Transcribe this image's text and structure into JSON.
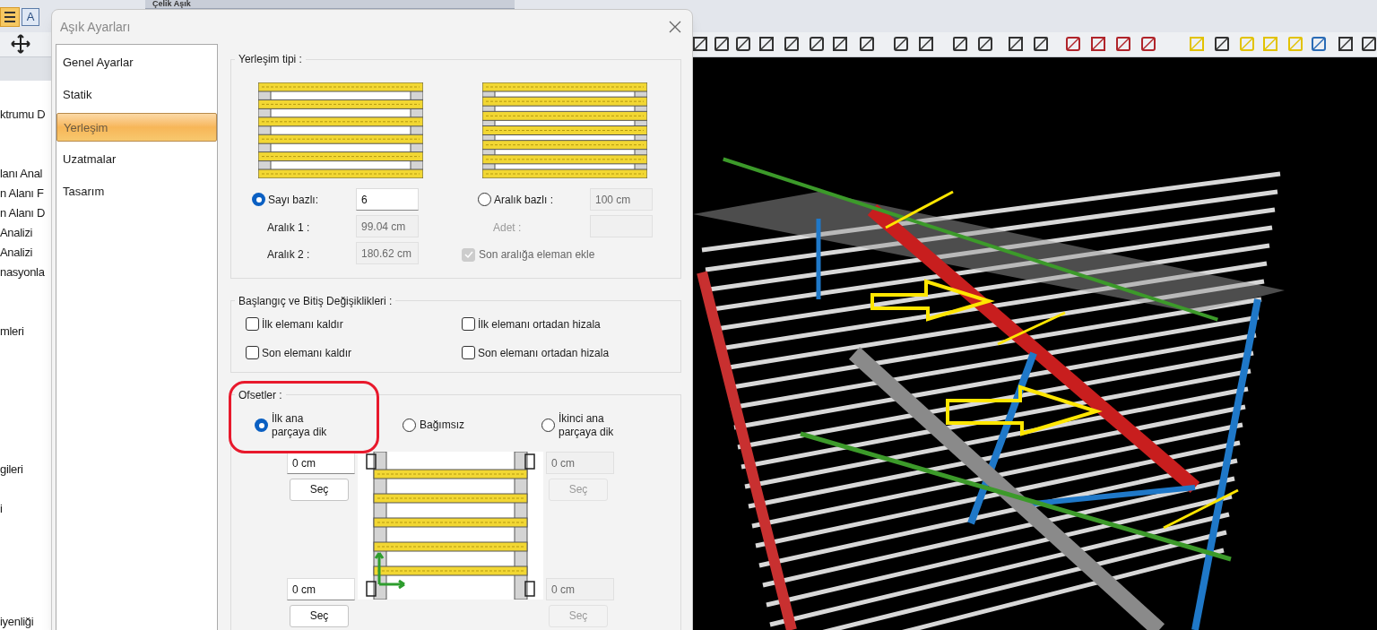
{
  "background": {
    "window_title": "Çelik Aşık",
    "text_tool": "A",
    "tree_items": [
      "ktrumu D",
      "lanı Anal",
      "n Alanı F",
      "n Alanı D",
      "Analizi",
      "Analizi",
      "nasyonla",
      "mleri",
      "gileri",
      "i",
      "iyenliği"
    ]
  },
  "dialog": {
    "title": "Aşık Ayarları",
    "nav": [
      {
        "label": "Genel Ayarlar",
        "selected": false
      },
      {
        "label": "Statik",
        "selected": false
      },
      {
        "label": "Yerleşim",
        "selected": true
      },
      {
        "label": "Uzatmalar",
        "selected": false
      },
      {
        "label": "Tasarım",
        "selected": false
      }
    ],
    "placement": {
      "title": "Yerleşim tipi :",
      "count_option": {
        "label": "Sayı bazlı:",
        "selected": true,
        "value": "6"
      },
      "interval_1": {
        "label": "Aralık 1 :",
        "value": "99.04 cm",
        "disabled": true
      },
      "interval_2": {
        "label": "Aralık 2 :",
        "value": "180.62 cm",
        "disabled": true
      },
      "spacing_option": {
        "label": "Aralık bazlı :",
        "selected": false,
        "value": "100 cm",
        "disabled": true
      },
      "quantity": {
        "label": "Adet :",
        "disabled": true
      },
      "add_last": {
        "label": "Son aralığa eleman ekle",
        "checked": true,
        "disabled": true
      }
    },
    "changes": {
      "title": "Başlangıç ve Bitiş Değişiklikleri :",
      "checkboxes": [
        {
          "label": "İlk elemanı kaldır",
          "checked": false
        },
        {
          "label": "İlk elemanı ortadan hizala",
          "checked": false
        },
        {
          "label": "Son elemanı kaldır",
          "checked": false
        },
        {
          "label": "Son elemanı ortadan hizala",
          "checked": false
        }
      ]
    },
    "offsets": {
      "title": "Ofsetler :",
      "highlighted": true,
      "modes": [
        {
          "label": "İlk ana parçaya dik",
          "selected": true
        },
        {
          "label": "Bağımsız",
          "selected": false
        },
        {
          "label": "İkinci ana parçaya dik",
          "selected": false
        }
      ],
      "inputs": [
        {
          "value": "0 cm",
          "disabled": false
        },
        {
          "value": "0 cm",
          "disabled": true
        },
        {
          "value": "0 cm",
          "disabled": false
        },
        {
          "value": "0 cm",
          "disabled": true
        }
      ],
      "buttons": [
        {
          "label": "Seç",
          "disabled": false
        },
        {
          "label": "Seç",
          "disabled": true
        },
        {
          "label": "Seç",
          "disabled": false
        },
        {
          "label": "Seç",
          "disabled": true
        }
      ]
    }
  }
}
